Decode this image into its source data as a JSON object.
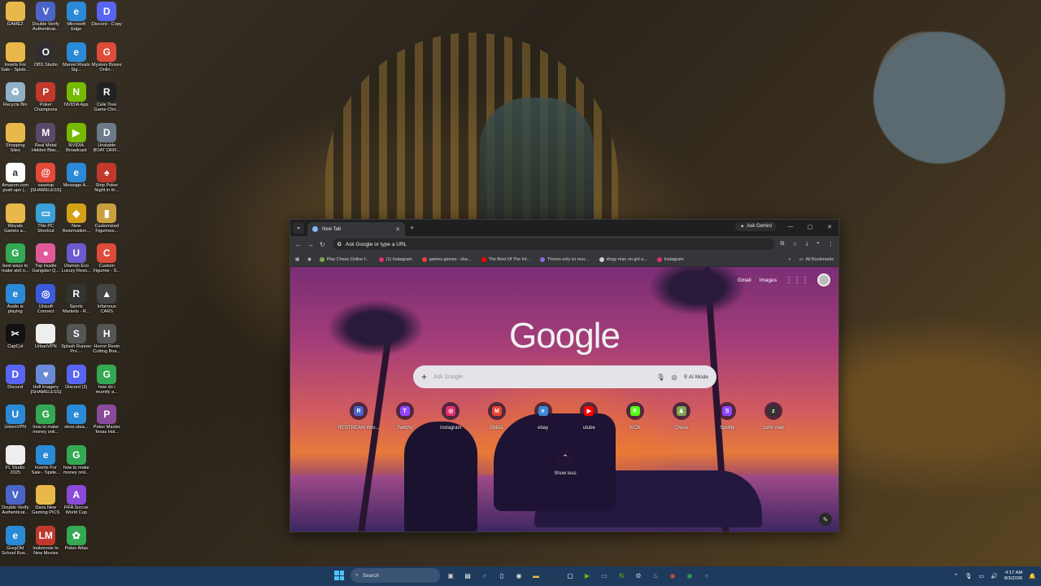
{
  "desktop": {
    "icons": [
      {
        "label": "GAMEZ",
        "icon": "folder-icon",
        "color": "#e8b84a",
        "glyph": ""
      },
      {
        "label": "Double Verify Authenticat...",
        "icon": "shield-icon",
        "color": "#4a64c8",
        "glyph": "V"
      },
      {
        "label": "Microsoft Edge",
        "icon": "edge-icon",
        "color": "#2a8ad8",
        "glyph": "e"
      },
      {
        "label": "Discord - Copy",
        "icon": "discord-icon",
        "color": "#5865f2",
        "glyph": "D"
      },
      {
        "label": "Inverts For Sale - Spide...",
        "icon": "folder-icon",
        "color": "#e8b84a",
        "glyph": ""
      },
      {
        "label": "OBS Studio",
        "icon": "obs-icon",
        "color": "#302e31",
        "glyph": "O"
      },
      {
        "label": "Marvel Rivals Sig...",
        "icon": "edge-icon",
        "color": "#2a8ad8",
        "glyph": "e"
      },
      {
        "label": "Mystery Boxes Onlin...",
        "icon": "chrome-icon",
        "color": "#dd4b39",
        "glyph": "G"
      },
      {
        "label": "Recycle Bin",
        "icon": "recycle-bin-icon",
        "color": "#8fb2c8",
        "glyph": "♻"
      },
      {
        "label": "Poker Champions",
        "icon": "poker-icon",
        "color": "#c0392b",
        "glyph": "P"
      },
      {
        "label": "NVIDIA App",
        "icon": "nvidia-icon",
        "color": "#76b900",
        "glyph": "N"
      },
      {
        "label": "Cele Tree Game Chri...",
        "icon": "game-icon",
        "color": "#222222",
        "glyph": "R"
      },
      {
        "label": "Shopping Sites",
        "icon": "folder-icon",
        "color": "#e8b84a",
        "glyph": ""
      },
      {
        "label": "Real Metal Hidden Blac...",
        "icon": "game-icon",
        "color": "#5a4a6a",
        "glyph": "M"
      },
      {
        "label": "NVIDIA Broadcast",
        "icon": "nvidia-broadcast-icon",
        "color": "#76b900",
        "glyph": "▶"
      },
      {
        "label": "Unstable BOAT DRIF...",
        "icon": "file-icon",
        "color": "#6c7a89",
        "glyph": "D"
      },
      {
        "label": "Amazon.com push ups (...",
        "icon": "amazon-icon",
        "color": "#ffffff",
        "glyph": "a"
      },
      {
        "label": "vasetup [SHAMELESS]",
        "icon": "setup-icon",
        "color": "#e34a3a",
        "glyph": "@"
      },
      {
        "label": "Message A...",
        "icon": "edge-icon",
        "color": "#2a8ad8",
        "glyph": "e"
      },
      {
        "label": "Strip Poker Night in th...",
        "icon": "cards-icon",
        "color": "#c0392b",
        "glyph": "♠"
      },
      {
        "label": "Weyals Games a...",
        "icon": "folder-icon",
        "color": "#e8b84a",
        "glyph": ""
      },
      {
        "label": "This PC Shortcut",
        "icon": "monitor-icon",
        "color": "#3aa0d8",
        "glyph": "▭"
      },
      {
        "label": "New Reservation...",
        "icon": "app-icon",
        "color": "#d4a017",
        "glyph": "◆"
      },
      {
        "label": "Customized Figurines...",
        "icon": "file-icon",
        "color": "#c8a040",
        "glyph": "▮"
      },
      {
        "label": "best ways to make alot o...",
        "icon": "chrome-icon",
        "color": "#34a853",
        "glyph": "G"
      },
      {
        "label": "Top Hustle Gangster Q...",
        "icon": "app-icon",
        "color": "#e05a9a",
        "glyph": "●"
      },
      {
        "label": "Ulaman Eco Luxury Reso...",
        "icon": "app-icon",
        "color": "#6a5acd",
        "glyph": "U"
      },
      {
        "label": "Custom Figurine - S...",
        "icon": "chrome-icon",
        "color": "#dd4b39",
        "glyph": "C"
      },
      {
        "label": "Audio is playing",
        "icon": "edge-icon",
        "color": "#2a8ad8",
        "glyph": "e"
      },
      {
        "label": "Ubisoft Connect",
        "icon": "ubisoft-icon",
        "color": "#3b5bdb",
        "glyph": "◎"
      },
      {
        "label": "Sports Markets - R...",
        "icon": "app-icon",
        "color": "#333333",
        "glyph": "R"
      },
      {
        "label": "Infamous CARS",
        "icon": "game-icon",
        "color": "#444444",
        "glyph": "▲"
      },
      {
        "label": "CapCut",
        "icon": "capcut-icon",
        "color": "#111111",
        "glyph": "✂"
      },
      {
        "label": "UrbanVPN",
        "icon": "file-icon",
        "color": "#eeeeee",
        "glyph": ""
      },
      {
        "label": "Splash Runner Pro ...",
        "icon": "file-icon",
        "color": "#555555",
        "glyph": "S"
      },
      {
        "label": "Horror Resin Cutting Boa...",
        "icon": "file-icon",
        "color": "#555555",
        "glyph": "H"
      },
      {
        "label": "Discord",
        "icon": "discord-icon",
        "color": "#5865f2",
        "glyph": "D"
      },
      {
        "label": "Hell Imagery [SHAMELESS]",
        "icon": "app-icon",
        "color": "#6a8ad8",
        "glyph": "♥"
      },
      {
        "label": "Discord (2)",
        "icon": "discord-icon",
        "color": "#5865f2",
        "glyph": "D"
      },
      {
        "label": "how do i mumify a...",
        "icon": "chrome-icon",
        "color": "#34a853",
        "glyph": "G"
      },
      {
        "label": "UrbenVPN",
        "icon": "vpn-icon",
        "color": "#2a8ad8",
        "glyph": "U"
      },
      {
        "label": "how to make money onli...",
        "icon": "chrome-icon",
        "color": "#34a853",
        "glyph": "G"
      },
      {
        "label": "store.stea...",
        "icon": "edge-icon",
        "color": "#2a8ad8",
        "glyph": "e"
      },
      {
        "label": "Poker Master Texas Hol...",
        "icon": "poker-icon",
        "color": "#8a4a9a",
        "glyph": "P"
      },
      {
        "label": "FL Studio 2025",
        "icon": "file-icon",
        "color": "#eeeeee",
        "glyph": ""
      },
      {
        "label": "Inverts For Sale - Spide...",
        "icon": "edge-icon",
        "color": "#2a8ad8",
        "glyph": "e"
      },
      {
        "label": "how to make money onli...",
        "icon": "chrome-icon",
        "color": "#34a853",
        "glyph": "G"
      },
      {
        "label": "",
        "icon": "",
        "color": "transparent",
        "glyph": ""
      },
      {
        "label": "Double Verify Authenticat...",
        "icon": "shield-icon",
        "color": "#4a64c8",
        "glyph": "V"
      },
      {
        "label": "Dans New Gaming PICS",
        "icon": "folder-icon",
        "color": "#e8b84a",
        "glyph": ""
      },
      {
        "label": "FIFA Soccer World Cup",
        "icon": "game-icon",
        "color": "#8a4ad8",
        "glyph": "A"
      },
      {
        "label": "",
        "icon": "",
        "color": "transparent",
        "glyph": ""
      },
      {
        "label": "GregOld School Run...",
        "icon": "edge-icon",
        "color": "#2a8ad8",
        "glyph": "e"
      },
      {
        "label": "lookmovie to New Movies",
        "icon": "app-icon",
        "color": "#c0392b",
        "glyph": "LM"
      },
      {
        "label": "Poker Atlas",
        "icon": "poker-icon",
        "color": "#34a853",
        "glyph": "✿"
      },
      {
        "label": "",
        "icon": "",
        "color": "transparent",
        "glyph": ""
      }
    ]
  },
  "browser": {
    "tab_title": "New Tab",
    "gemini_label": "Ask Gemini",
    "omnibox_placeholder": "Ask Google or type a URL",
    "bookmarks": [
      {
        "label": "Play Chess Online f...",
        "color": "#7fa650"
      },
      {
        "label": "(1) Instagram",
        "color": "#e1306c"
      },
      {
        "label": "games games - sha...",
        "color": "#ea4335"
      },
      {
        "label": "The Best Of The Int...",
        "color": "#ff0000"
      },
      {
        "label": "Theres only so muc...",
        "color": "#8a6ad8"
      },
      {
        "label": "dingy man on girl a...",
        "color": "#cccccc"
      },
      {
        "label": "Instagram",
        "color": "#e1306c"
      }
    ],
    "all_bookmarks": "All Bookmarks",
    "ntp": {
      "gmail": "Gmail",
      "images": "Images",
      "logo": "Google",
      "search_placeholder": "Ask Google",
      "ai_mode": "AI Mode",
      "show_less": "Show less",
      "shortcuts": [
        {
          "label": "RESTREAM Wro...",
          "color": "#4a64c8",
          "glyph": "R"
        },
        {
          "label": "Twitchy",
          "color": "#9146ff",
          "glyph": "T"
        },
        {
          "label": "instagram",
          "color": "#e1306c",
          "glyph": "◎"
        },
        {
          "label": "GMAIL",
          "color": "#ea4335",
          "glyph": "M"
        },
        {
          "label": "ebay",
          "color": "#3a8ad8",
          "glyph": "e"
        },
        {
          "label": "utube",
          "color": "#ff0000",
          "glyph": "▶"
        },
        {
          "label": "KICK",
          "color": "#53fc18",
          "glyph": "K"
        },
        {
          "label": "Chess",
          "color": "#7fa650",
          "glyph": "♟"
        },
        {
          "label": "Spotify",
          "color": "#9146ff",
          "glyph": "S"
        },
        {
          "label": "zoho mail",
          "color": "#333333",
          "glyph": "z"
        }
      ]
    }
  },
  "taskbar": {
    "search_label": "Search",
    "apps": [
      {
        "name": "task-view",
        "color": "#cccccc",
        "glyph": "▣"
      },
      {
        "name": "widgets",
        "color": "#ffffff",
        "glyph": "▤"
      },
      {
        "name": "edge",
        "color": "#2a8ad8",
        "glyph": "e"
      },
      {
        "name": "notepad",
        "color": "#ffffff",
        "glyph": "▯"
      },
      {
        "name": "chrome",
        "color": "#dddddd",
        "glyph": "◉"
      },
      {
        "name": "file-explorer",
        "color": "#e8b84a",
        "glyph": "▬"
      },
      {
        "name": "obs",
        "color": "#444444",
        "glyph": "◎"
      },
      {
        "name": "media",
        "color": "#ffffff",
        "glyph": "▢"
      },
      {
        "name": "nvidia-broadcast",
        "color": "#76b900",
        "glyph": "▶"
      },
      {
        "name": "photos",
        "color": "#bbbbbb",
        "glyph": "▭"
      },
      {
        "name": "nvidia",
        "color": "#76b900",
        "glyph": "N"
      },
      {
        "name": "settings",
        "color": "#cccccc",
        "glyph": "⚙"
      },
      {
        "name": "steam",
        "color": "#cccccc",
        "glyph": "♨"
      },
      {
        "name": "chrome-2",
        "color": "#dd4b39",
        "glyph": "◉"
      },
      {
        "name": "chrome-3",
        "color": "#34a853",
        "glyph": "◉"
      },
      {
        "name": "edge-2",
        "color": "#2a8ad8",
        "glyph": "e"
      }
    ],
    "time": "4:17 AM",
    "date": "8/3/2026"
  }
}
